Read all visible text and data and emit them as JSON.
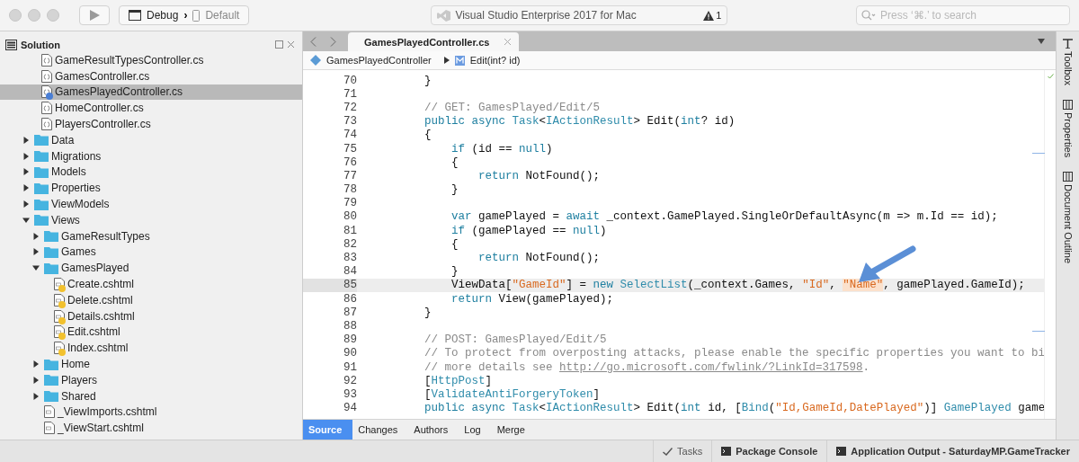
{
  "toolbar": {
    "config": "Debug",
    "separator": "›",
    "device": "Default",
    "status": "Visual Studio Enterprise 2017 for Mac",
    "warnings": "1",
    "search": {
      "placeholder": "Press ‘⌘.’ to search"
    }
  },
  "sidebar": {
    "title": "Solution",
    "controller_files": [
      {
        "label": "GameResultTypesController.cs",
        "kind": "cs",
        "selected": false
      },
      {
        "label": "GamesController.cs",
        "kind": "cs",
        "selected": false
      },
      {
        "label": "GamesPlayedController.cs",
        "kind": "cs",
        "selected": true,
        "color": "#4a7fd6"
      },
      {
        "label": "HomeController.cs",
        "kind": "cs",
        "selected": false
      },
      {
        "label": "PlayersController.cs",
        "kind": "cs",
        "selected": false
      }
    ],
    "tree": [
      {
        "label": "Data",
        "kind": "folder",
        "expanded": false
      },
      {
        "label": "Migrations",
        "kind": "folder",
        "expanded": false
      },
      {
        "label": "Models",
        "kind": "folder",
        "expanded": false
      },
      {
        "label": "Properties",
        "kind": "folder",
        "expanded": false
      },
      {
        "label": "ViewModels",
        "kind": "folder",
        "expanded": false
      },
      {
        "label": "Views",
        "kind": "folder",
        "expanded": true,
        "children": [
          {
            "label": "GameResultTypes",
            "kind": "folder",
            "expanded": false
          },
          {
            "label": "Games",
            "kind": "folder",
            "expanded": false
          },
          {
            "label": "GamesPlayed",
            "kind": "folder",
            "expanded": true,
            "children": [
              {
                "label": "Create.cshtml",
                "kind": "cshtml",
                "color": "#f2c12e"
              },
              {
                "label": "Delete.cshtml",
                "kind": "cshtml",
                "color": "#f2c12e"
              },
              {
                "label": "Details.cshtml",
                "kind": "cshtml",
                "color": "#f2c12e"
              },
              {
                "label": "Edit.cshtml",
                "kind": "cshtml",
                "color": "#f2c12e"
              },
              {
                "label": "Index.cshtml",
                "kind": "cshtml",
                "color": "#f2c12e"
              }
            ]
          },
          {
            "label": "Home",
            "kind": "folder",
            "expanded": false
          },
          {
            "label": "Players",
            "kind": "folder",
            "expanded": false
          },
          {
            "label": "Shared",
            "kind": "folder",
            "expanded": false
          },
          {
            "label": "_ViewImports.cshtml",
            "kind": "cshtml"
          },
          {
            "label": "_ViewStart.cshtml",
            "kind": "cshtml"
          }
        ]
      }
    ]
  },
  "editor": {
    "tab": "GamesPlayedController.cs",
    "breadcrumb": [
      "GamesPlayedController",
      "Edit(int? id)"
    ],
    "lines": [
      {
        "num": "70",
        "current": false,
        "tokens": [
          {
            "kind": "plain",
            "text": "        }"
          }
        ]
      },
      {
        "num": "71",
        "current": false
      },
      {
        "num": "72",
        "current": false,
        "tokens": [
          {
            "kind": "comment",
            "text": "        // GET: GamesPlayed/Edit/5"
          }
        ]
      },
      {
        "num": "73",
        "current": false,
        "tokens": [
          {
            "kind": "keyword",
            "text": "        public async "
          },
          {
            "kind": "type",
            "text": "Task"
          },
          {
            "kind": "plain",
            "text": "<"
          },
          {
            "kind": "type",
            "text": "IActionResult"
          },
          {
            "kind": "plain",
            "text": "> Edit("
          },
          {
            "kind": "keyword",
            "text": "int"
          },
          {
            "kind": "plain",
            "text": "? id)"
          }
        ]
      },
      {
        "num": "74",
        "current": false,
        "tokens": [
          {
            "kind": "plain",
            "text": "        {"
          }
        ]
      },
      {
        "num": "75",
        "current": false,
        "tokens": [
          {
            "kind": "keyword",
            "text": "            if"
          },
          {
            "kind": "plain",
            "text": " (id == "
          },
          {
            "kind": "keyword",
            "text": "null"
          },
          {
            "kind": "plain",
            "text": ")"
          }
        ]
      },
      {
        "num": "76",
        "current": false,
        "tokens": [
          {
            "kind": "plain",
            "text": "            {"
          }
        ]
      },
      {
        "num": "77",
        "current": false,
        "tokens": [
          {
            "kind": "keyword",
            "text": "                return"
          },
          {
            "kind": "plain",
            "text": " NotFound();"
          }
        ]
      },
      {
        "num": "78",
        "current": false,
        "tokens": [
          {
            "kind": "plain",
            "text": "            }"
          }
        ]
      },
      {
        "num": "79",
        "current": false
      },
      {
        "num": "80",
        "current": false,
        "tokens": [
          {
            "kind": "keyword",
            "text": "            var"
          },
          {
            "kind": "plain",
            "text": " gamePlayed = "
          },
          {
            "kind": "keyword",
            "text": "await"
          },
          {
            "kind": "plain",
            "text": " _context.GamePlayed.SingleOrDefaultAsync(m => m.Id == id);"
          }
        ]
      },
      {
        "num": "81",
        "current": false,
        "tokens": [
          {
            "kind": "keyword",
            "text": "            if"
          },
          {
            "kind": "plain",
            "text": " (gamePlayed == "
          },
          {
            "kind": "keyword",
            "text": "null"
          },
          {
            "kind": "plain",
            "text": ")"
          }
        ]
      },
      {
        "num": "82",
        "current": false,
        "tokens": [
          {
            "kind": "plain",
            "text": "            {"
          }
        ]
      },
      {
        "num": "83",
        "current": false,
        "tokens": [
          {
            "kind": "keyword",
            "text": "                return"
          },
          {
            "kind": "plain",
            "text": " NotFound();"
          }
        ]
      },
      {
        "num": "84",
        "current": false,
        "tokens": [
          {
            "kind": "plain",
            "text": "            }"
          }
        ]
      },
      {
        "num": "85",
        "current": true,
        "tokens": [
          {
            "kind": "plain",
            "text": "            ViewData["
          },
          {
            "kind": "string",
            "text": "\"GameId\""
          },
          {
            "kind": "plain",
            "text": "] = "
          },
          {
            "kind": "keyword",
            "text": "new "
          },
          {
            "kind": "type",
            "text": "SelectList"
          },
          {
            "kind": "plain",
            "text": "(_context.Games, "
          },
          {
            "kind": "string",
            "text": "\"Id\""
          },
          {
            "kind": "plain",
            "text": ", "
          },
          {
            "kind": "match",
            "text": "\"Name\""
          },
          {
            "kind": "plain",
            "text": ", gamePlayed.GameId);"
          }
        ]
      },
      {
        "num": "86",
        "current": false,
        "tokens": [
          {
            "kind": "keyword",
            "text": "            return"
          },
          {
            "kind": "plain",
            "text": " View(gamePlayed);"
          }
        ]
      },
      {
        "num": "87",
        "current": false,
        "tokens": [
          {
            "kind": "plain",
            "text": "        }"
          }
        ]
      },
      {
        "num": "88",
        "current": false
      },
      {
        "num": "89",
        "current": false,
        "tokens": [
          {
            "kind": "comment",
            "text": "        // POST: GamesPlayed/Edit/5"
          }
        ]
      },
      {
        "num": "90",
        "current": false,
        "tokens": [
          {
            "kind": "comment",
            "text": "        // To protect from overposting attacks, please enable the specific properties you want to bi"
          }
        ]
      },
      {
        "num": "91",
        "current": false,
        "tokens": [
          {
            "kind": "comment",
            "text": "        // more details see "
          },
          {
            "kind": "link",
            "text": "http://go.microsoft.com/fwlink/?LinkId=317598"
          },
          {
            "kind": "comment",
            "text": "."
          }
        ]
      },
      {
        "num": "92",
        "current": false,
        "tokens": [
          {
            "kind": "plain",
            "text": "        ["
          },
          {
            "kind": "type",
            "text": "HttpPost"
          },
          {
            "kind": "plain",
            "text": "]"
          }
        ]
      },
      {
        "num": "93",
        "current": false,
        "tokens": [
          {
            "kind": "plain",
            "text": "        ["
          },
          {
            "kind": "type",
            "text": "ValidateAntiForgeryToken"
          },
          {
            "kind": "plain",
            "text": "]"
          }
        ]
      },
      {
        "num": "94",
        "current": false,
        "tokens": [
          {
            "kind": "keyword",
            "text": "        public async "
          },
          {
            "kind": "type",
            "text": "Task"
          },
          {
            "kind": "plain",
            "text": "<"
          },
          {
            "kind": "type",
            "text": "IActionResult"
          },
          {
            "kind": "plain",
            "text": "> Edit("
          },
          {
            "kind": "keyword",
            "text": "int"
          },
          {
            "kind": "plain",
            "text": " id, ["
          },
          {
            "kind": "type",
            "text": "Bind"
          },
          {
            "kind": "plain",
            "text": "("
          },
          {
            "kind": "string",
            "text": "\"Id,GameId,DatePlayed\""
          },
          {
            "kind": "plain",
            "text": ")] "
          },
          {
            "kind": "type",
            "text": "GamePlayed"
          },
          {
            "kind": "plain",
            "text": " game"
          }
        ]
      }
    ],
    "bottom_tabs": [
      {
        "label": "Source",
        "selected": true
      },
      {
        "label": "Changes",
        "selected": false
      },
      {
        "label": "Authors",
        "selected": false
      },
      {
        "label": "Log",
        "selected": false
      },
      {
        "label": "Merge",
        "selected": false
      }
    ]
  },
  "dock": [
    "Toolbox",
    "Properties",
    "Document Outline"
  ],
  "status_bar": [
    {
      "label": "Tasks",
      "kind": "check"
    },
    {
      "label": "Package Console",
      "kind": "terminal"
    },
    {
      "label": "Application Output - SaturdayMP.GameTracker",
      "kind": "terminal"
    }
  ]
}
